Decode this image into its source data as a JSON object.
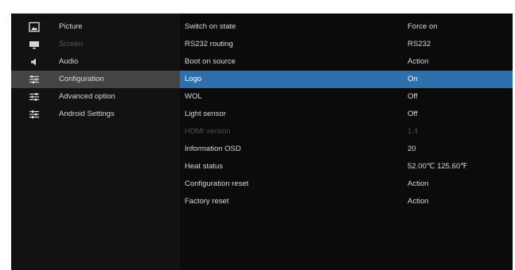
{
  "sidebar": {
    "items": [
      {
        "label": "Picture",
        "icon": "picture-icon"
      },
      {
        "label": "Screen",
        "icon": "screen-icon"
      },
      {
        "label": "Audio",
        "icon": "audio-icon"
      },
      {
        "label": "Configuration",
        "icon": "configuration-icon"
      },
      {
        "label": "Advanced option",
        "icon": "advanced-option-icon"
      },
      {
        "label": "Android Settings",
        "icon": "android-settings-icon"
      }
    ],
    "selected": "Configuration"
  },
  "settings": {
    "rows": [
      {
        "label": "Switch on state",
        "value": "Force on"
      },
      {
        "label": "RS232 routing",
        "value": "RS232"
      },
      {
        "label": "Boot on source",
        "value": "Action"
      },
      {
        "label": "Logo",
        "value": "On"
      },
      {
        "label": "WOL",
        "value": "Off"
      },
      {
        "label": "Light sensor",
        "value": "Off"
      },
      {
        "label": "HDMI version",
        "value": "1.4"
      },
      {
        "label": "Information OSD",
        "value": "20"
      },
      {
        "label": "Heat status",
        "value": "52.00℃ 125.60℉"
      },
      {
        "label": "Configuration reset",
        "value": "Action"
      },
      {
        "label": "Factory reset",
        "value": "Action"
      }
    ],
    "selected": "Logo",
    "disabled": [
      "HDMI version"
    ]
  },
  "colors": {
    "background": "#0b0b0c",
    "sidebar_background": "#121214",
    "sidebar_selected": "#454548",
    "row_selected": "#2f6fae",
    "text": "#d8d8d8",
    "text_disabled": "#4f4f52"
  }
}
